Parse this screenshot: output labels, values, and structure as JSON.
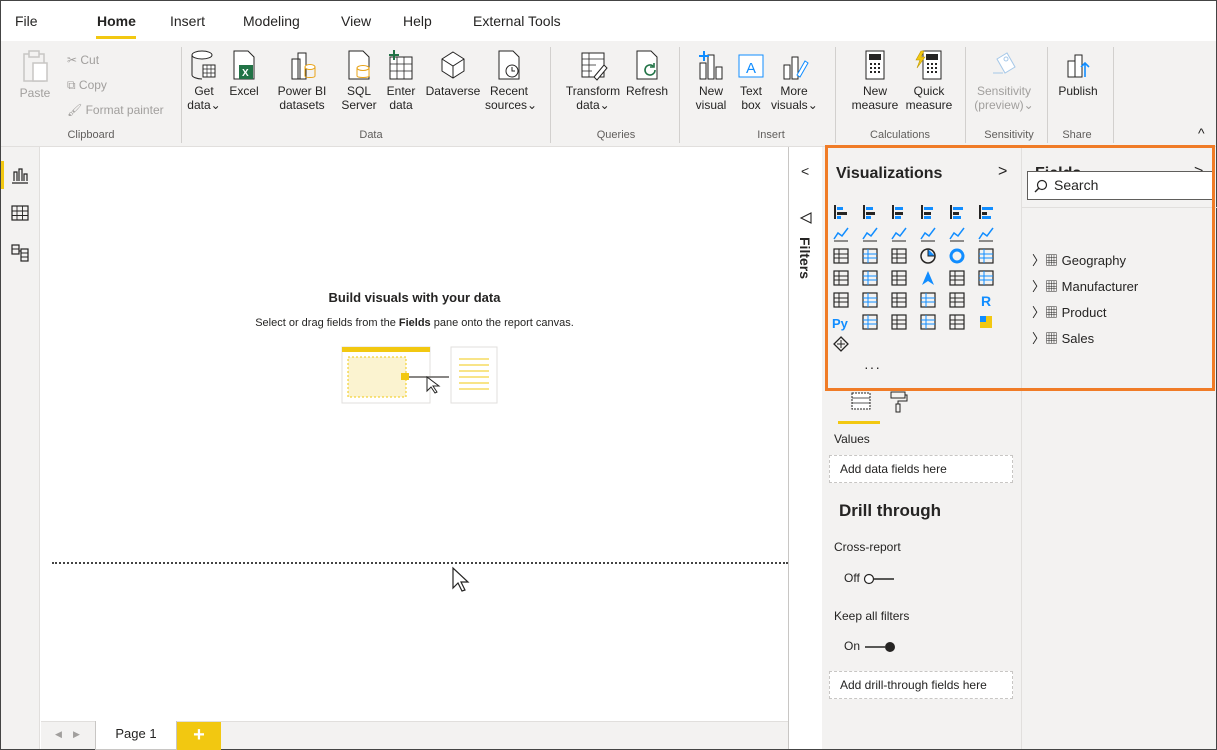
{
  "menu": {
    "file": "File",
    "home": "Home",
    "insert": "Insert",
    "modeling": "Modeling",
    "view": "View",
    "help": "Help",
    "external_tools": "External Tools"
  },
  "ribbon": {
    "clipboard": {
      "paste": "Paste",
      "cut": "Cut",
      "copy": "Copy",
      "format_painter": "Format painter",
      "label": "Clipboard"
    },
    "data": {
      "get_data_1": "Get",
      "get_data_2": "data",
      "excel": "Excel",
      "power_bi_1": "Power BI",
      "power_bi_2": "datasets",
      "sql_1": "SQL",
      "sql_2": "Server",
      "enter_1": "Enter",
      "enter_2": "data",
      "dataverse": "Dataverse",
      "recent_1": "Recent",
      "recent_2": "sources",
      "label": "Data"
    },
    "queries": {
      "transform_1": "Transform",
      "transform_2": "data",
      "refresh": "Refresh",
      "label": "Queries"
    },
    "insert": {
      "new_visual_1": "New",
      "new_visual_2": "visual",
      "text_box_1": "Text",
      "text_box_2": "box",
      "more_1": "More",
      "more_2": "visuals",
      "label": "Insert"
    },
    "calculations": {
      "new_measure_1": "New",
      "new_measure_2": "measure",
      "quick_1": "Quick",
      "quick_2": "measure",
      "label": "Calculations"
    },
    "sensitivity": {
      "btn_1": "Sensitivity",
      "btn_2": "(preview)",
      "label": "Sensitivity"
    },
    "share": {
      "publish": "Publish",
      "label": "Share"
    },
    "dropdown_glyph": "⌄",
    "collapse_glyph": "^"
  },
  "canvas": {
    "title": "Build visuals with your data",
    "sub_pre": "Select or drag fields from the ",
    "sub_bold": "Fields",
    "sub_post": " pane onto the report canvas."
  },
  "tabs": {
    "page1": "Page 1",
    "add": "+",
    "prev": "◀",
    "next": "▶"
  },
  "filters": {
    "label": "Filters",
    "collapse": "<"
  },
  "viz": {
    "title": "Visualizations",
    "expand": ">",
    "more": "···",
    "values_label": "Values",
    "values_placeholder": "Add data fields here",
    "drill_title": "Drill through",
    "cross_report": "Cross-report",
    "cross_state": "Off",
    "keep_filters": "Keep all filters",
    "keep_state": "On",
    "drill_placeholder": "Add drill-through fields here"
  },
  "fields": {
    "title": "Fields",
    "expand": ">",
    "search_placeholder": "Search",
    "tables": [
      "Geography",
      "Manufacturer",
      "Product",
      "Sales"
    ]
  },
  "colors": {
    "accent": "#f2c811",
    "highlight": "#f07c27",
    "blue": "#118dff"
  }
}
